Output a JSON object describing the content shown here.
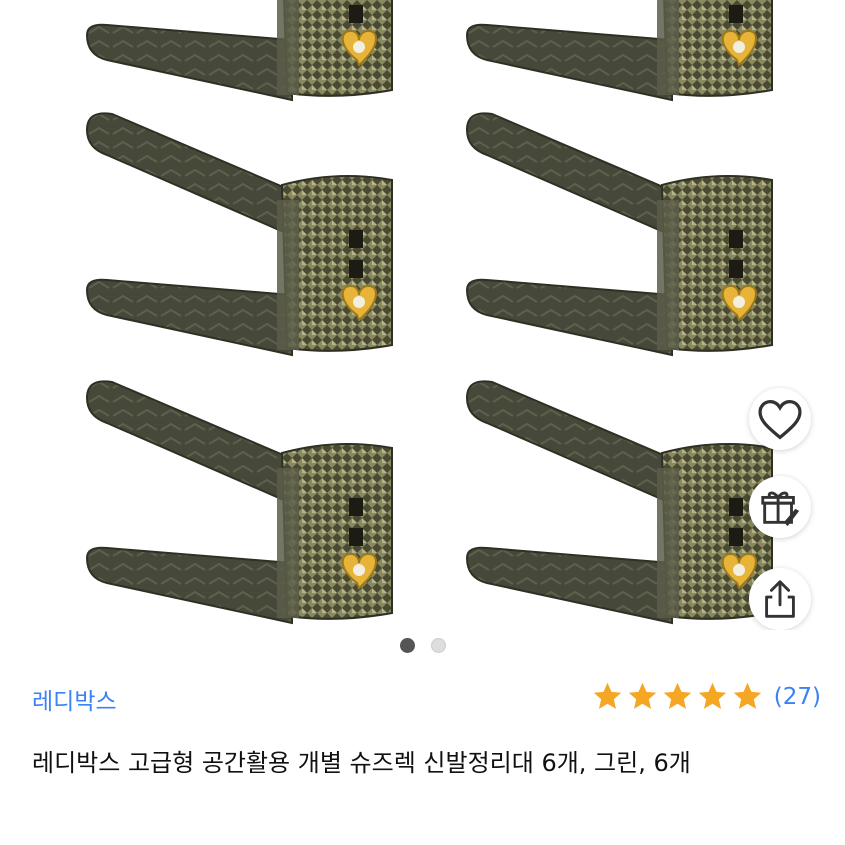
{
  "product": {
    "brand": "레디박스",
    "title": "레디박스 고급형 공간활용 개별 슈즈렉 신발정리대 6개, 그린, 6개",
    "rating": {
      "stars": 5,
      "review_count": "(27)"
    },
    "image_alt": "shoe-rack-stack-photo"
  },
  "gallery": {
    "total_images": 2,
    "active_index": 0,
    "dot_active_color": "#555555",
    "dot_inactive_color": "#cccccc"
  },
  "actions": {
    "wishlist_icon": "heart-icon",
    "gift_icon": "gift-icon",
    "share_icon": "share-icon"
  },
  "colors": {
    "accent": "#3b82f6",
    "star": "#f5a623",
    "rack": "#3f4130",
    "rack_light": "#6b6a4c",
    "heart": "#e7b338"
  }
}
